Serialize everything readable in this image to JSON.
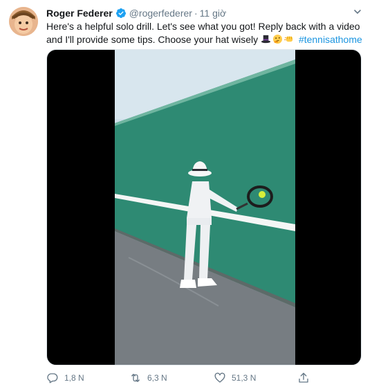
{
  "tweet": {
    "author_name": "Roger Federer",
    "handle": "@rogerfederer",
    "separator": "·",
    "time": "11 giờ",
    "text_line1": "Here's a helpful solo drill. Let's see what you got! Reply back with a video",
    "text_line2": "and I'll provide some tips. Choose your hat wisely",
    "hashtag": "#tennisathome",
    "emojis": [
      "top-hat-emoji",
      "thinking-face-emoji",
      "fist-bump-emoji"
    ]
  },
  "media": {
    "type": "video",
    "icon": "video-thumbnail"
  },
  "actions": {
    "reply_count": "1,8 N",
    "retweet_count": "6,3 N",
    "like_count": "51,3 N"
  },
  "colors": {
    "link": "#1b95e0",
    "secondary_text": "#657786",
    "verified": "#1da1f2",
    "wall_green": "#2e8a73"
  }
}
